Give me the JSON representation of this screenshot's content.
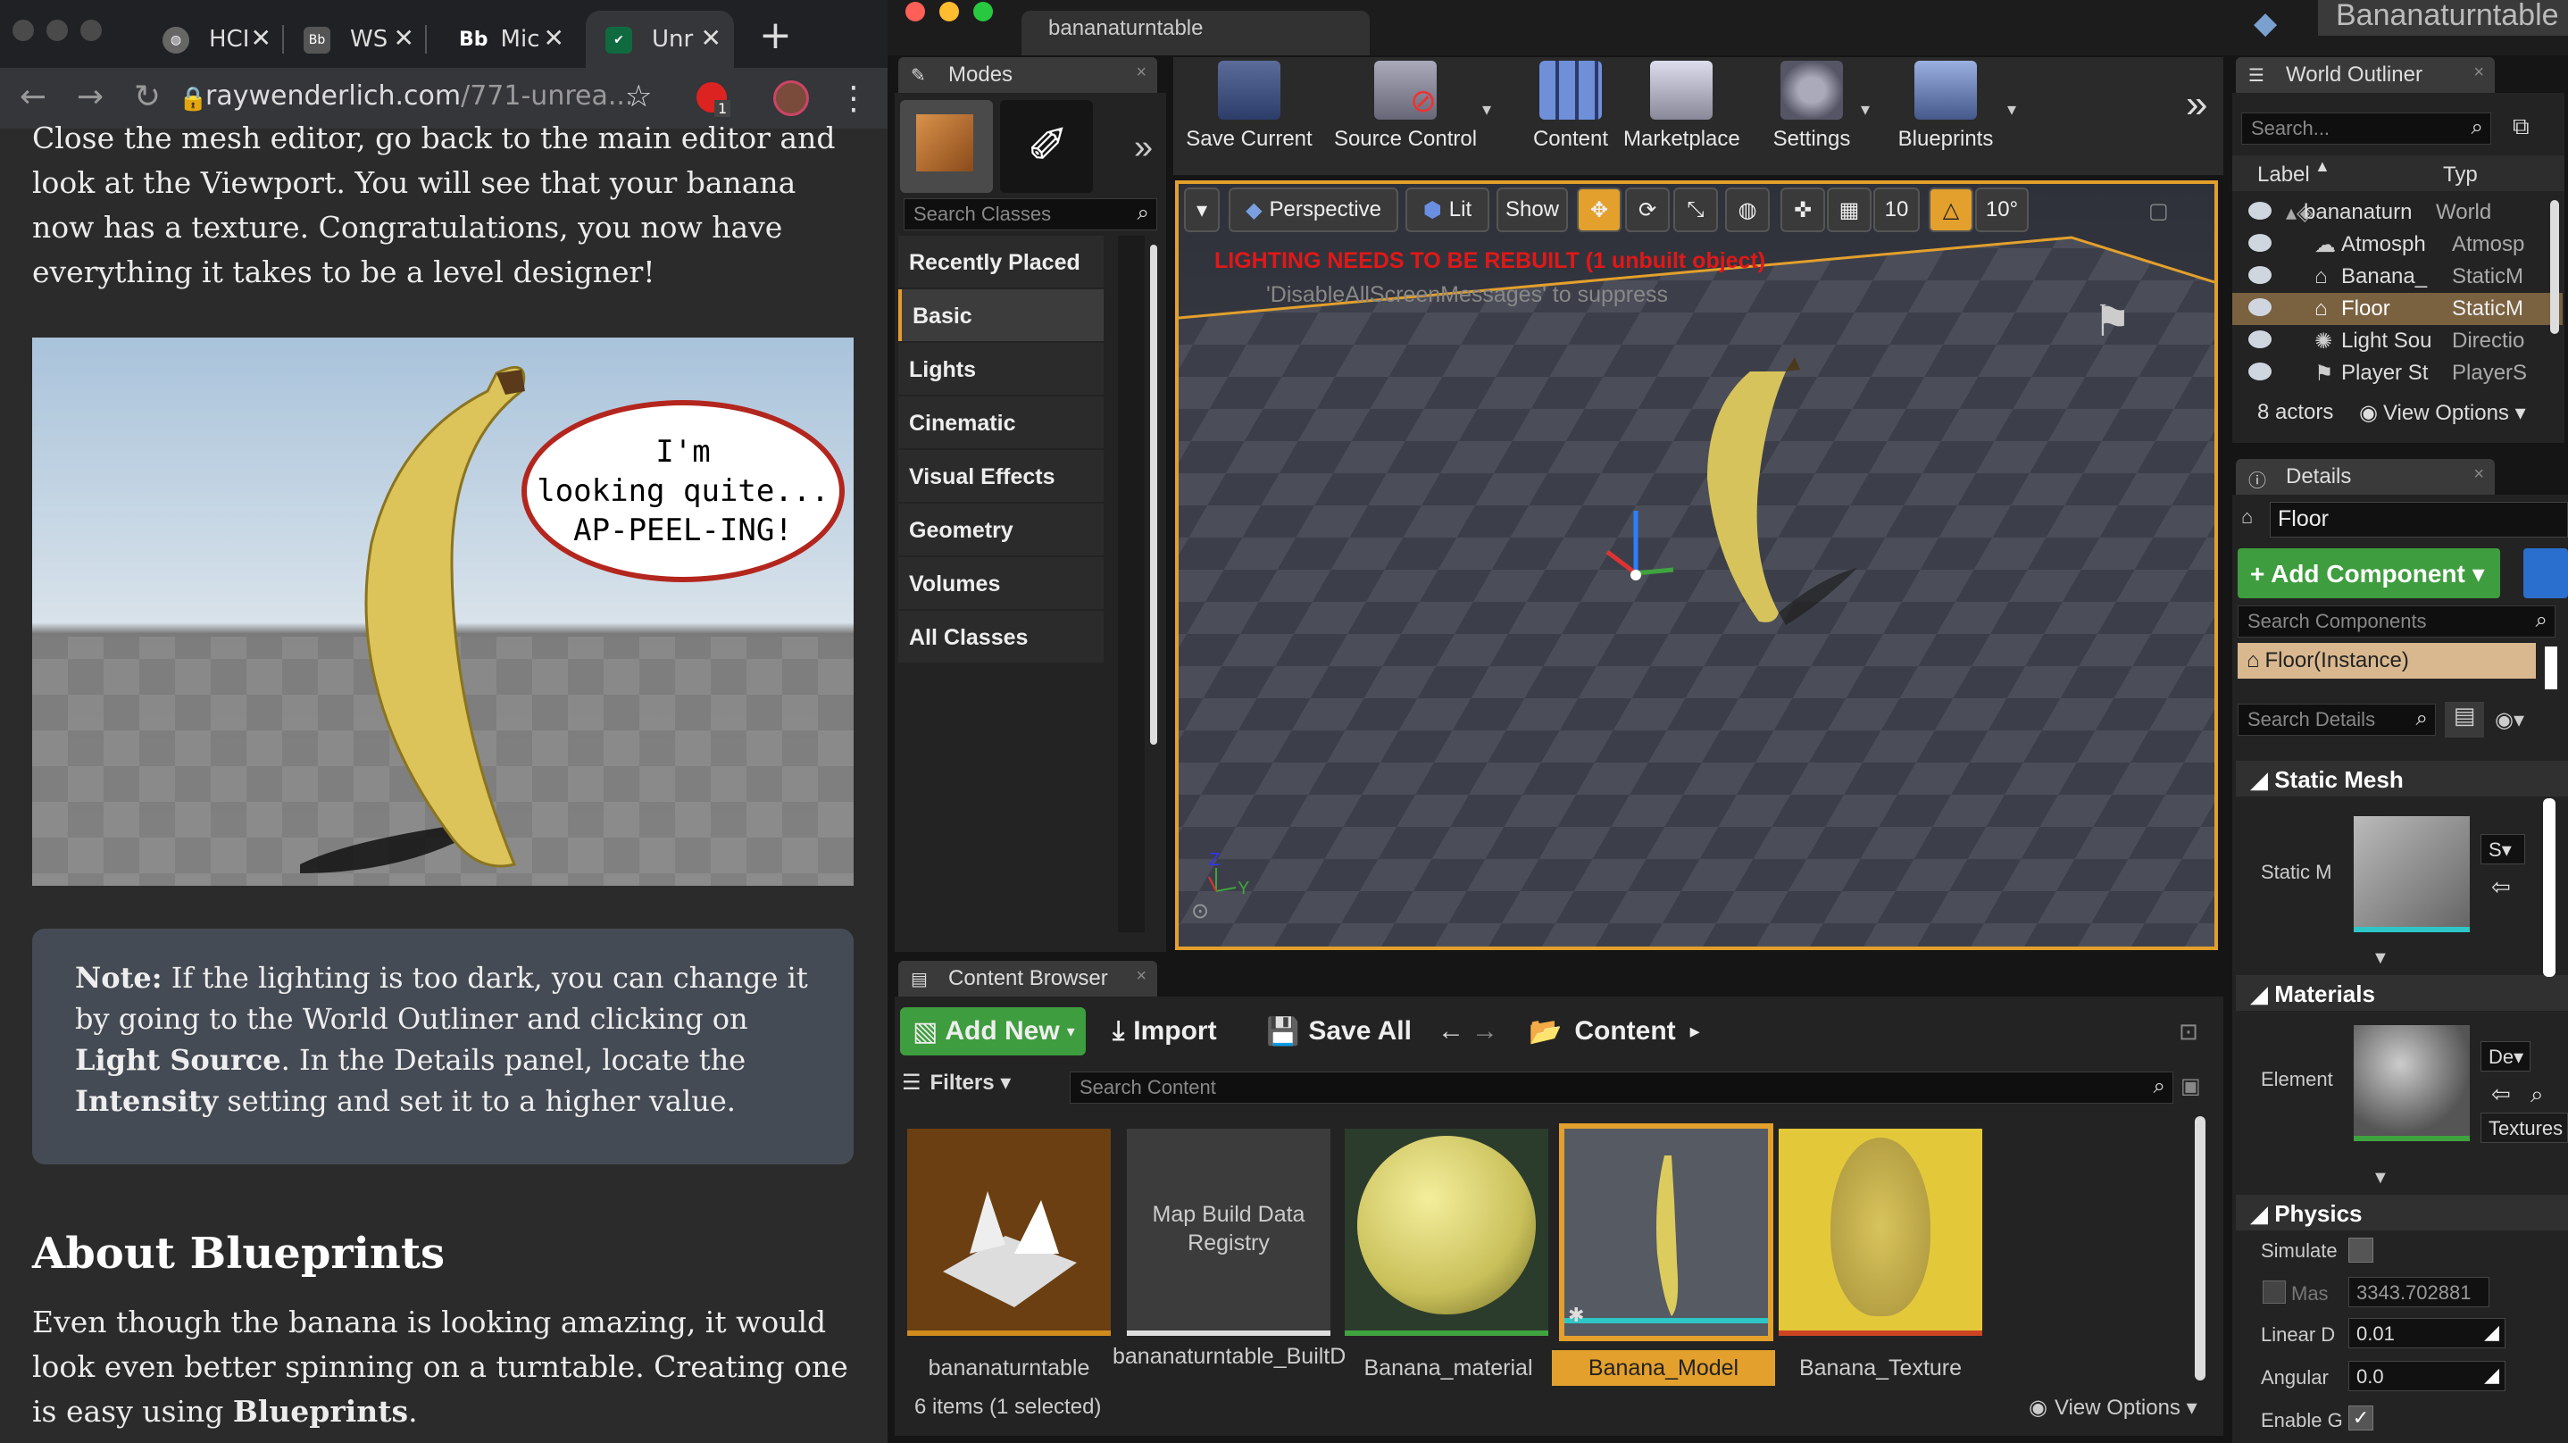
{
  "browser": {
    "tabs": [
      {
        "label": "HCI",
        "icon": "globe-icon"
      },
      {
        "label": "WS",
        "icon": "bb-icon"
      },
      {
        "label": "Mic",
        "icon": "bb-icon"
      },
      {
        "label": "Unr",
        "icon": "rw-icon"
      }
    ],
    "fav_bb": "Bb",
    "url_host": "raywenderlich.com",
    "url_path": "/771-unrea...",
    "ext_badge": "1"
  },
  "article": {
    "intro": "Close the mesh editor, go back to the main editor and look at the Viewport. You will see that your banana now has a texture. Congratulations, you now have everything it takes to be a level designer!",
    "bubble_line1": "I'm",
    "bubble_line2": "looking quite...",
    "bubble_line3": "AP-PEEL-ING!",
    "note_bold": "Note:",
    "note_t1": " If the lighting is too dark, you can change it by going to the World Outliner and clicking on ",
    "note_b2": "Light Source",
    "note_t2": ". In the Details panel, locate the ",
    "note_b3": "Intensity",
    "note_t3": " setting and set it to a higher value.",
    "heading": "About Blueprints",
    "para2_a": "Even though the banana is looking amazing, it would look even better spinning on a turntable. Creating one is easy using ",
    "para2_b": "Blueprints",
    "para2_c": "."
  },
  "ue": {
    "window_tab": "bananaturntable",
    "app_title": "Bananaturntable",
    "modes": {
      "tab": "Modes",
      "search_placeholder": "Search Classes",
      "items": [
        "Recently Placed",
        "Basic",
        "Lights",
        "Cinematic",
        "Visual Effects",
        "Geometry",
        "Volumes",
        "All Classes"
      ]
    },
    "toolbar": [
      "Save Current",
      "Source Control",
      "Content",
      "Marketplace",
      "Settings",
      "Blueprints"
    ],
    "viewport": {
      "perspective": "Perspective",
      "lit": "Lit",
      "show": "Show",
      "grid": "10",
      "angle": "10°",
      "warning": "LIGHTING NEEDS TO BE REBUILT (1 unbuilt object)",
      "suppress": "'DisableAllScreenMessages' to suppress",
      "axis_z": "Z",
      "axis_y": "Y"
    },
    "outliner": {
      "tab": "World Outliner",
      "search_placeholder": "Search...",
      "col_label": "Label",
      "col_type": "Typ",
      "rows": [
        {
          "label": "bananaturn",
          "type": "World"
        },
        {
          "label": "Atmosph",
          "type": "Atmosp"
        },
        {
          "label": "Banana_",
          "type": "StaticM"
        },
        {
          "label": "Floor",
          "type": "StaticM"
        },
        {
          "label": "Light Sou",
          "type": "Directio"
        },
        {
          "label": "Player St",
          "type": "PlayerS"
        }
      ],
      "count": "8 actors",
      "view_options": "View Options"
    },
    "details": {
      "tab": "Details",
      "name": "Floor",
      "add_component": "+ Add Component",
      "search_components": "Search Components",
      "instance": "Floor(Instance)",
      "search_details": "Search Details",
      "sec_mesh": "Static Mesh",
      "mesh_label": "Static M",
      "mesh_dd": "S",
      "sec_materials": "Materials",
      "element_label": "Element",
      "mat_dd": "De",
      "textures": "Textures",
      "sec_physics": "Physics",
      "simulate": "Simulate",
      "mass_label": "Mas",
      "mass_value": "3343.702881",
      "linear_label": "Linear D",
      "linear_value": "0.01",
      "angular_label": "Angular",
      "angular_value": "0.0",
      "enable_label": "Enable G"
    },
    "content_browser": {
      "tab": "Content Browser",
      "add_new": "Add New",
      "import": "Import",
      "save_all": "Save All",
      "path": "Content",
      "filters": "Filters",
      "search_placeholder": "Search Content",
      "map_build_text": "Map Build Data Registry",
      "assets": [
        "bananaturntable",
        "bananaturntable_BuiltData",
        "Banana_material",
        "Banana_Model",
        "Banana_Texture"
      ],
      "status": "6 items (1 selected)",
      "view_options": "View Options"
    }
  }
}
